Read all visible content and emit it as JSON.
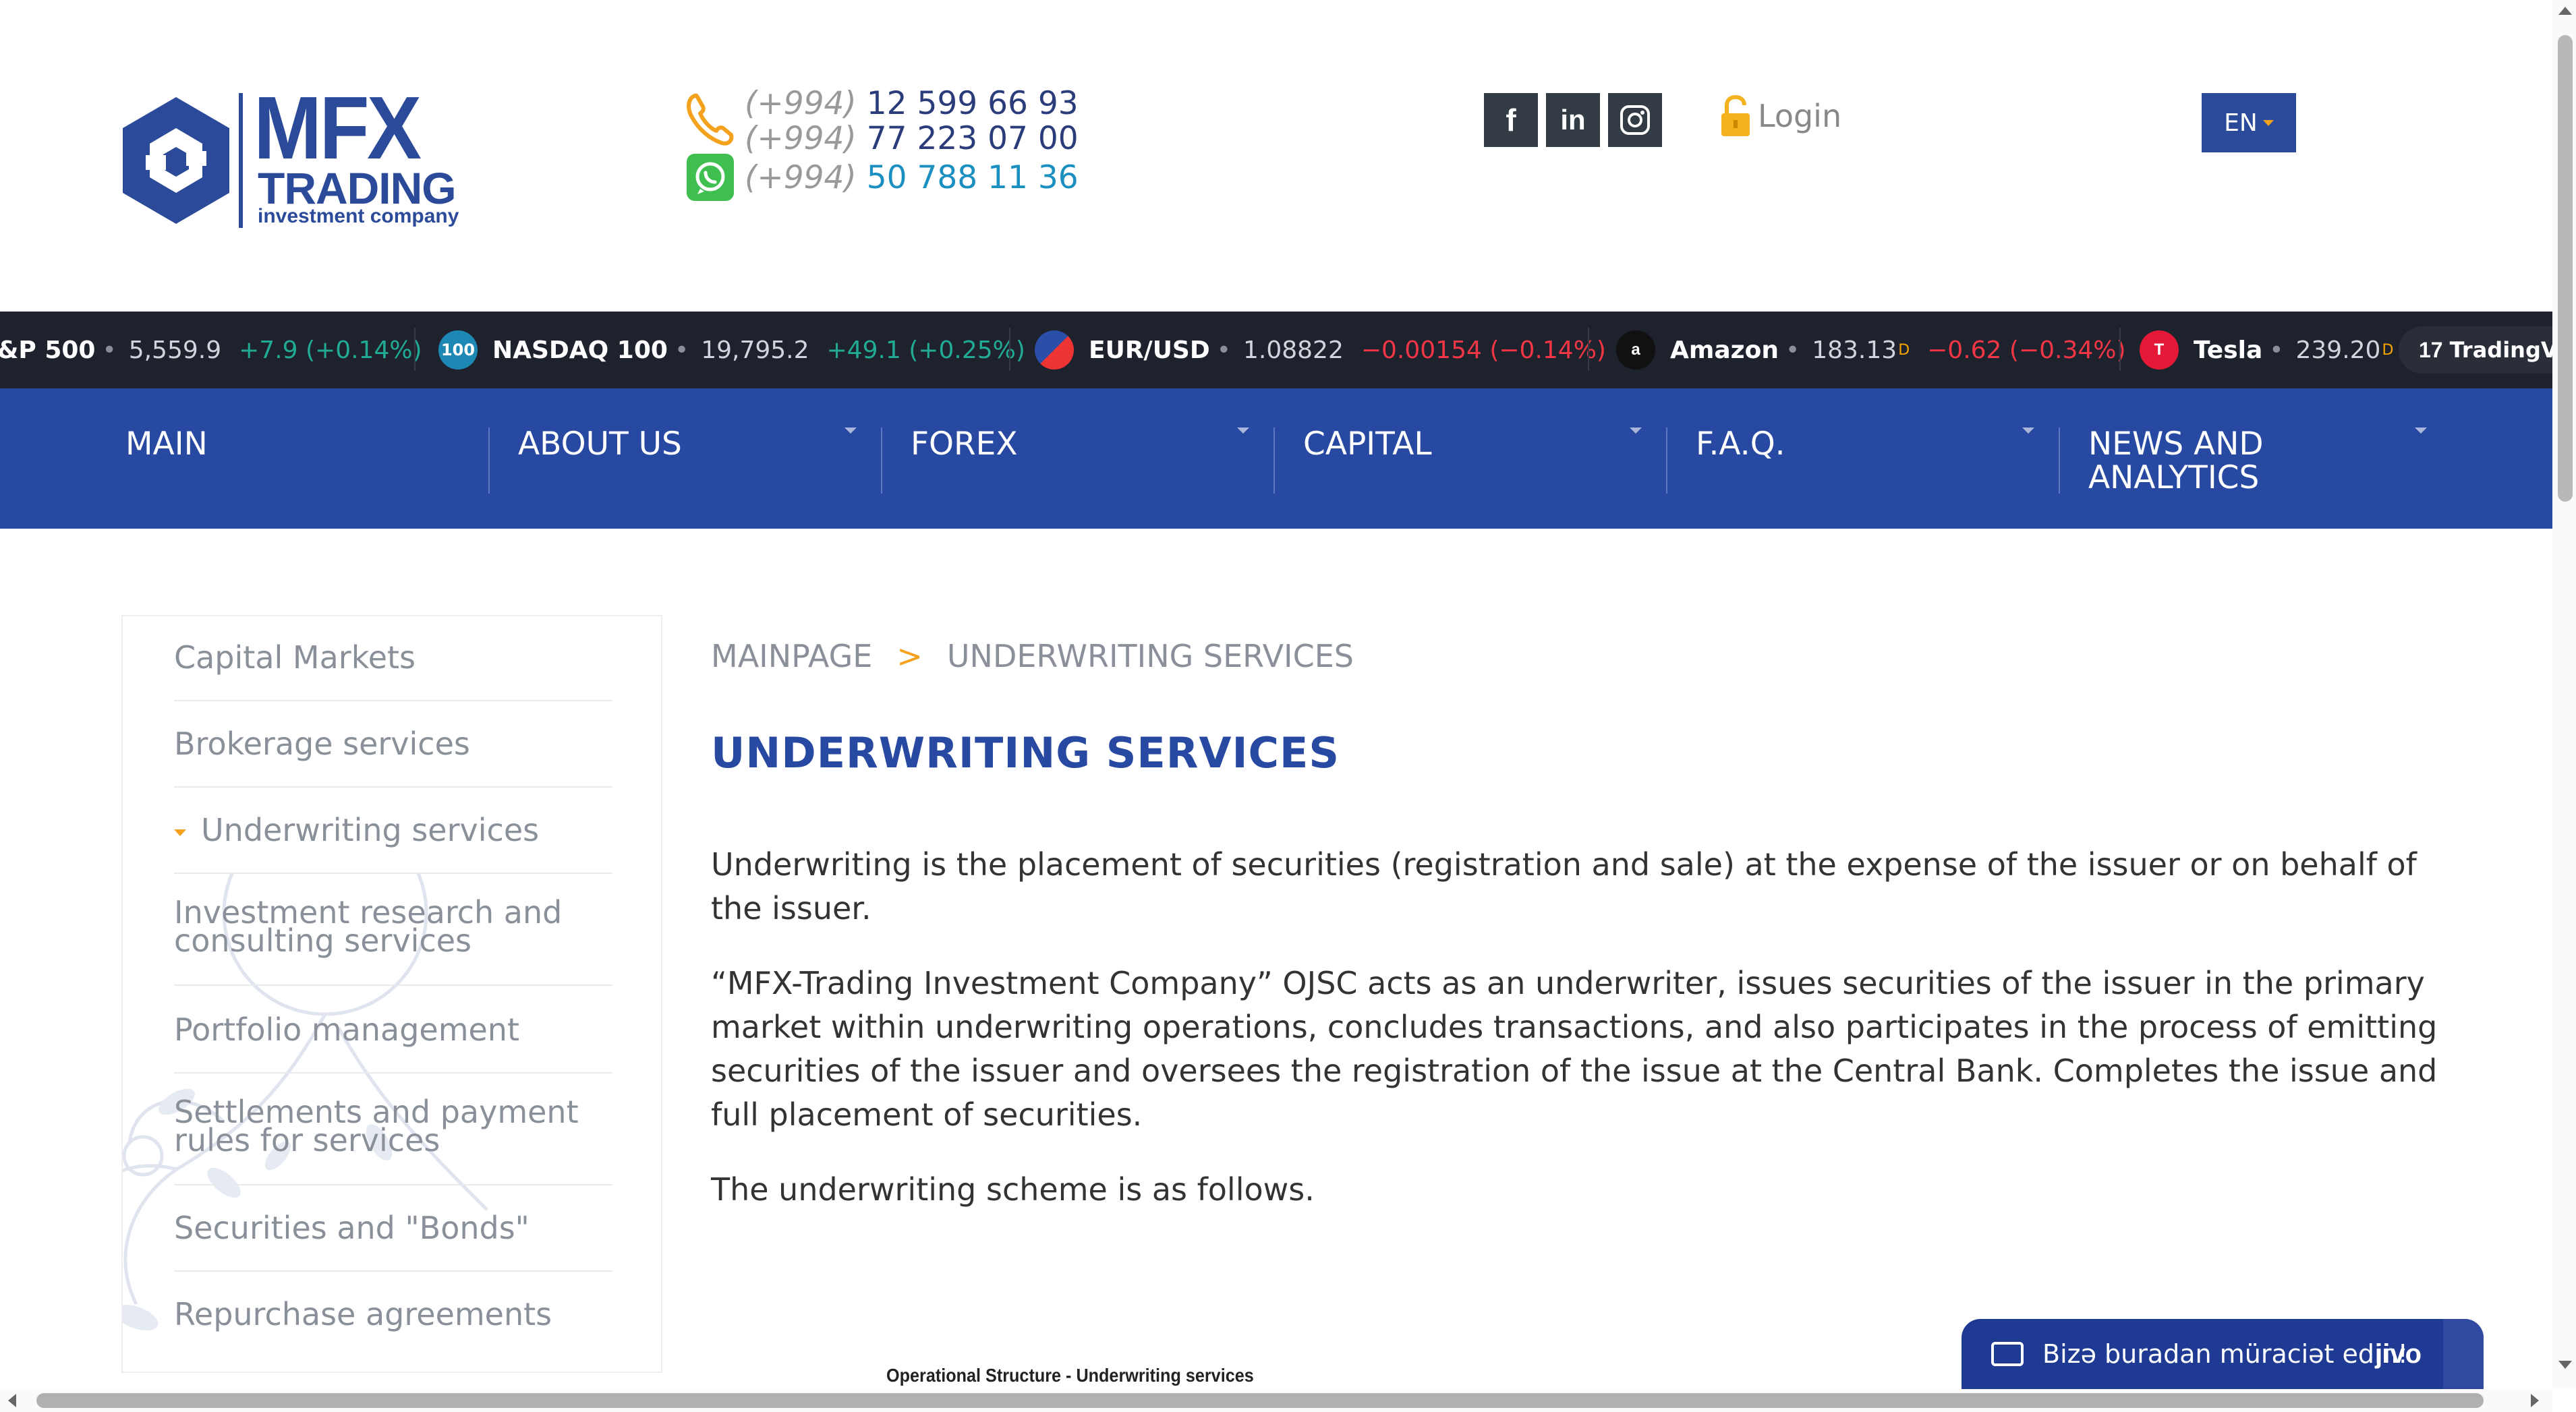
{
  "logo": {
    "big": "MFX",
    "mid": "TRADING",
    "small": "investment company"
  },
  "contacts": {
    "phones": [
      {
        "code": "(+994)",
        "number": "12 599 66 93"
      },
      {
        "code": "(+994)",
        "number": "77 223 07 00"
      }
    ],
    "whatsapp": {
      "code": "(+994)",
      "number": "50 788 11 36"
    }
  },
  "social": {
    "facebook": "f",
    "linkedin": "in",
    "instagram": "◎"
  },
  "login_label": "Login",
  "language": "EN",
  "ticker": {
    "items": [
      {
        "name": "&P 500",
        "value": "5,559.9",
        "change": "+7.9 (+0.14%)",
        "direction": "up"
      },
      {
        "name": "NASDAQ 100",
        "icon": "100",
        "value": "19,795.2",
        "change": "+49.1 (+0.25%)",
        "direction": "up"
      },
      {
        "name": "EUR/USD",
        "value": "1.08822",
        "change": "−0.00154 (−0.14%)",
        "direction": "down"
      },
      {
        "name": "Amazon",
        "icon": "a",
        "value": "183.13",
        "suffix": "D",
        "change": "−0.62 (−0.34%)",
        "direction": "down"
      },
      {
        "name": "Tesla",
        "icon": "T",
        "value": "239.20",
        "suffix": "D"
      }
    ],
    "brand": "TradingView"
  },
  "nav": {
    "items": [
      "MAIN",
      "ABOUT US",
      "FOREX",
      "CAPITAL",
      "F.A.Q.",
      "NEWS AND ANALYTICS"
    ]
  },
  "sidebar": {
    "items": [
      "Capital Markets",
      "Brokerage services",
      "Underwriting services",
      "Investment research and consulting services",
      "Portfolio management",
      "Settlements and payment rules for services",
      "Securities and \"Bonds\"",
      "Repurchase agreements"
    ],
    "active_index": 2
  },
  "breadcrumb": {
    "home": "MAINPAGE",
    "separator": ">",
    "current": "UNDERWRITING SERVICES"
  },
  "page": {
    "title": "UNDERWRITING SERVICES",
    "paragraphs": [
      "Underwriting is the placement of securities (registration and sale) at the expense of the issuer or on behalf of the issuer.",
      "“MFX-Trading Investment Company” OJSC acts as an underwriter, issues securities of the issuer in the primary market within underwriting operations, concludes transactions, and also participates in the process of emitting securities of the issuer and oversees the registration of the issue at the Central Bank. Completes the issue and full placement of securities.",
      "The underwriting scheme is as follows."
    ],
    "scheme_caption": "Operational Structure - Underwriting services"
  },
  "chat": {
    "label": "Bizə buradan müraciət edin!",
    "brand": "jivo"
  },
  "colors": {
    "brand_blue": "#2849a2",
    "accent_orange": "#f4a21e",
    "ticker_bg": "#1e222d",
    "up": "#22ab94",
    "down": "#f23645"
  }
}
